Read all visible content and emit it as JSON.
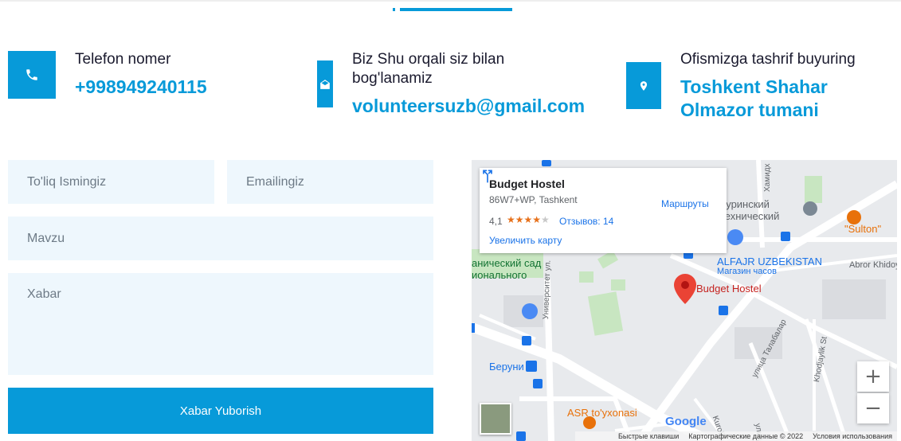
{
  "contacts": {
    "phone": {
      "label": "Telefon nomer",
      "value": "+998949240115",
      "icon": "phone-icon"
    },
    "email": {
      "label": "Biz Shu orqali siz bilan bog'lanamiz",
      "value": "volunteersuzb@gmail.com",
      "icon": "envelope-open-icon"
    },
    "address": {
      "label": "Ofismizga tashrif buyuring",
      "value_line1": "Toshkent Shahar",
      "value_line2": "Olmazor tumani",
      "icon": "map-pin-icon"
    }
  },
  "form": {
    "name_placeholder": "To'liq Ismingiz",
    "email_placeholder": "Emailingiz",
    "subject_placeholder": "Mavzu",
    "message_placeholder": "Xabar",
    "submit_label": "Xabar Yuborish"
  },
  "map": {
    "card": {
      "title": "Budget Hostel",
      "address": "86W7+WP, Tashkent",
      "rating": "4,1",
      "stars": "★★★★",
      "star_empty": "★",
      "reviews": "Отзывов: 14",
      "larger_map": "Увеличить карту",
      "routes": "Маршруты"
    },
    "labels": {
      "marker": "Budget Hostel",
      "turin_1": "Туринский",
      "turin_2": "технический",
      "sulton": "\"Sulton\"",
      "alfajr": "ALFAJR UZBEKISTAN",
      "clock_store": "Магазин часов",
      "abror": "Abror Khidoy",
      "garden_1": "анический сад",
      "garden_2": "ионального",
      "university_st": "Университет ул.",
      "beruni": "Беруни",
      "asr": "ASR to'yxonasi",
      "talabalar": "улица Талабалар",
      "khodjaylik": "Khodjaylik St",
      "kurolik": "Kurolik",
      "hamid": "Хамидх",
      "street_right": "улица Т"
    },
    "zoom_in": "+",
    "zoom_out": "−",
    "footer": {
      "shortcuts": "Быстрые клавиши",
      "data": "Картографические данные © 2022",
      "terms": "Условия использования"
    },
    "google": "Google"
  },
  "colors": {
    "accent": "#079ad9",
    "field_bg": "#eef7fd"
  }
}
